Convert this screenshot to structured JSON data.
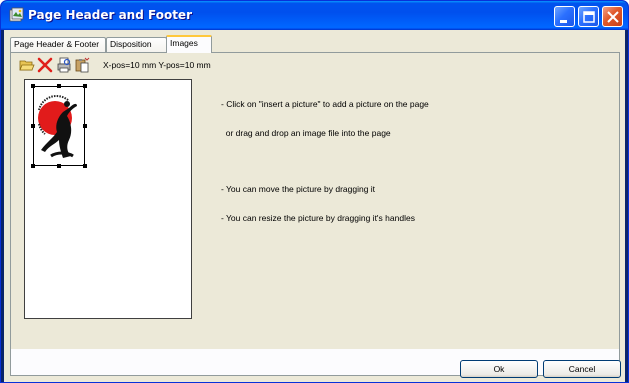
{
  "window": {
    "title": "Page Header and Footer"
  },
  "tabs": [
    {
      "label": "Page Header & Footer",
      "active": false
    },
    {
      "label": "Disposition",
      "active": false
    },
    {
      "label": "Images",
      "active": true
    }
  ],
  "toolbar": {
    "buttons": [
      {
        "name": "open-folder-icon",
        "tooltip": ""
      },
      {
        "name": "delete-icon",
        "tooltip": ""
      },
      {
        "name": "print-preview-icon",
        "tooltip": ""
      },
      {
        "name": "paste-icon",
        "tooltip": ""
      }
    ],
    "position_readout": "X-pos=10 mm  Y-pos=10 mm"
  },
  "instructions": {
    "lines": [
      "- Click on \"insert a picture\" to add a picture on the page",
      "  or drag and drop an image file into the page",
      "",
      "- You can move the picture by dragging it",
      "- You can resize the picture by dragging it's handles"
    ]
  },
  "buttons": {
    "ok": "Ok",
    "cancel": "Cancel"
  },
  "colors": {
    "titlebar": "#0053ee",
    "window_bg": "#ece9d8",
    "tab_highlight": "#ffc83c",
    "logo_red": "#e11b1b"
  }
}
